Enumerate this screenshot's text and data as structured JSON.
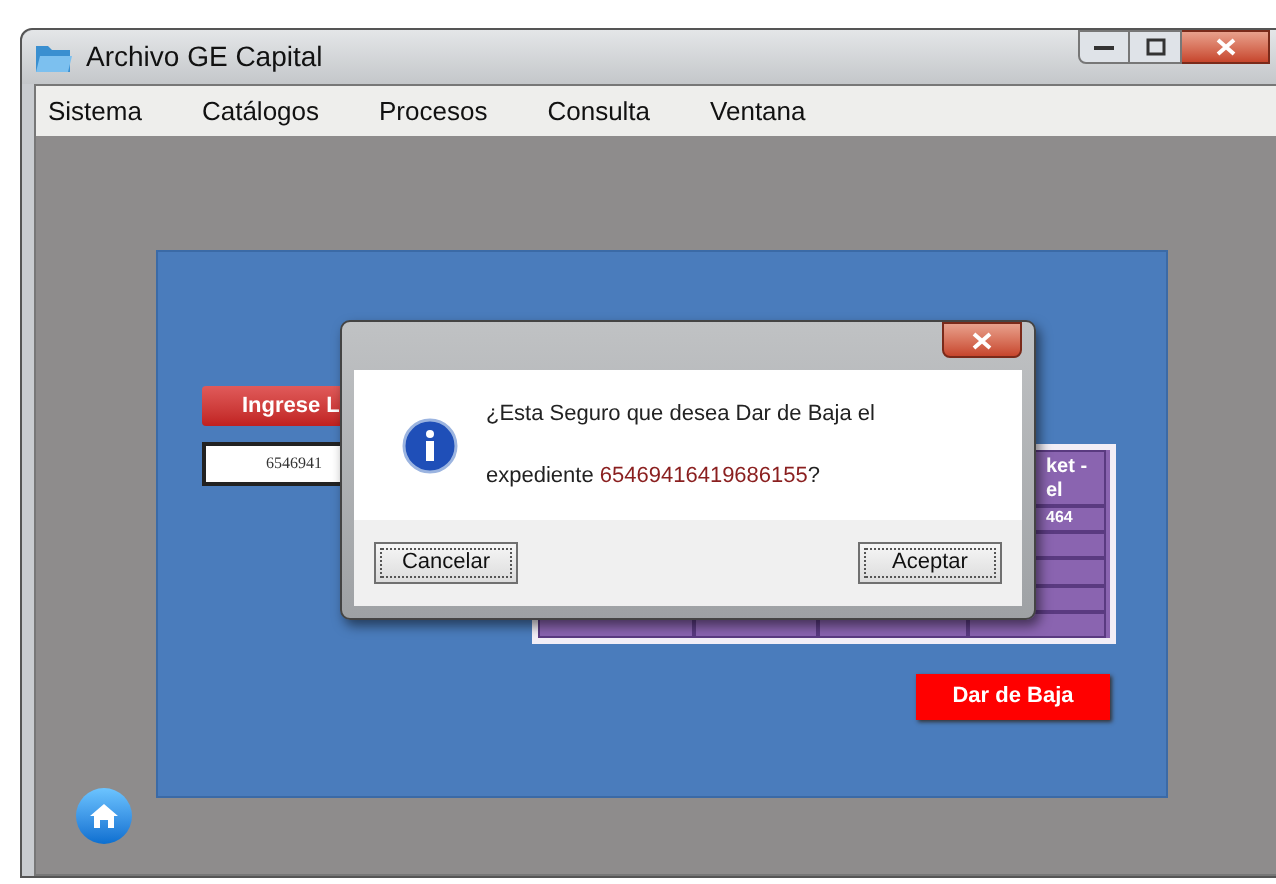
{
  "window": {
    "title": "Archivo GE Capital"
  },
  "menu": [
    "Sistema",
    "Catálogos",
    "Procesos",
    "Consulta",
    "Ventana"
  ],
  "form": {
    "prompt_button": "Ingrese L",
    "input_value": "6546941",
    "table": {
      "header": "ket -\nel",
      "rows": [
        "464",
        "",
        "",
        "",
        ""
      ]
    },
    "action_button": "Dar de Baja"
  },
  "dialog": {
    "message_start": "¿Esta Seguro que desea Dar de Baja el",
    "message_prefix": "expediente ",
    "record_number": "65469416419686155",
    "message_end": "?",
    "buttons": [
      "Cancelar",
      "Aceptar"
    ]
  }
}
